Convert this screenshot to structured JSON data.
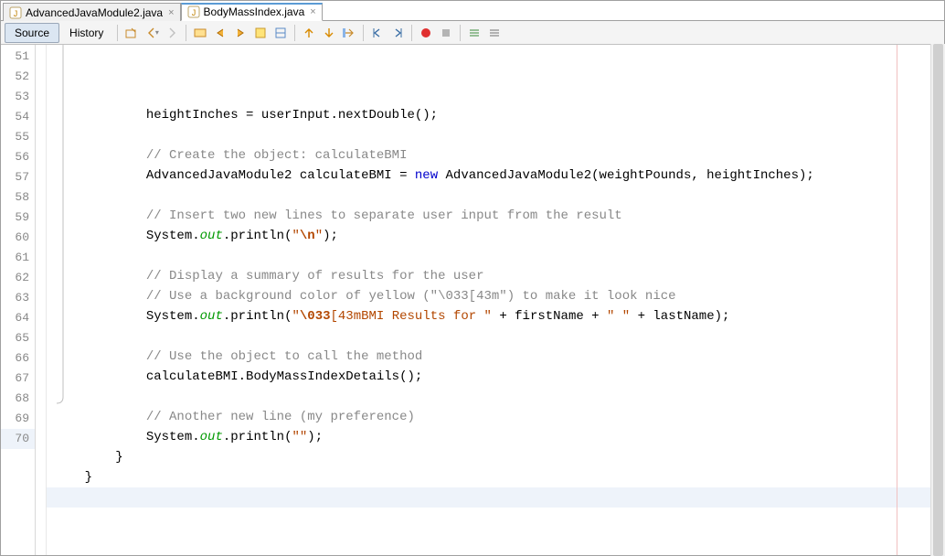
{
  "tabs": [
    {
      "label": "AdvancedJavaModule2.java",
      "active": false
    },
    {
      "label": "BodyMassIndex.java",
      "active": true
    }
  ],
  "toolbar": {
    "source_label": "Source",
    "history_label": "History"
  },
  "editor": {
    "first_line": 51,
    "last_line": 70,
    "cursor_line": 70,
    "lines": [
      {
        "n": 51,
        "indent": "            ",
        "tokens": [
          {
            "t": "pln",
            "s": "heightInches = userInput.nextDouble();"
          }
        ]
      },
      {
        "n": 52,
        "indent": "",
        "tokens": []
      },
      {
        "n": 53,
        "indent": "            ",
        "tokens": [
          {
            "t": "cmt",
            "s": "// Create the object: calculateBMI"
          }
        ]
      },
      {
        "n": 54,
        "indent": "            ",
        "tokens": [
          {
            "t": "pln",
            "s": "AdvancedJavaModule2 calculateBMI = "
          },
          {
            "t": "kw",
            "s": "new"
          },
          {
            "t": "pln",
            "s": " AdvancedJavaModule2(weightPounds, heightInches);"
          }
        ]
      },
      {
        "n": 55,
        "indent": "",
        "tokens": []
      },
      {
        "n": 56,
        "indent": "            ",
        "tokens": [
          {
            "t": "cmt",
            "s": "// Insert two new lines to separate user input from the result"
          }
        ]
      },
      {
        "n": 57,
        "indent": "            ",
        "tokens": [
          {
            "t": "pln",
            "s": "System."
          },
          {
            "t": "fld",
            "s": "out"
          },
          {
            "t": "pln",
            "s": ".println("
          },
          {
            "t": "str",
            "s": "\""
          },
          {
            "t": "esc",
            "s": "\\n"
          },
          {
            "t": "str",
            "s": "\""
          },
          {
            "t": "pln",
            "s": ");"
          }
        ]
      },
      {
        "n": 58,
        "indent": "",
        "tokens": []
      },
      {
        "n": 59,
        "indent": "            ",
        "tokens": [
          {
            "t": "cmt",
            "s": "// Display a summary of results for the user"
          }
        ]
      },
      {
        "n": 60,
        "indent": "            ",
        "tokens": [
          {
            "t": "cmt",
            "s": "// Use a background color of yellow (\"\\033[43m\") to make it look nice"
          }
        ]
      },
      {
        "n": 61,
        "indent": "            ",
        "tokens": [
          {
            "t": "pln",
            "s": "System."
          },
          {
            "t": "fld",
            "s": "out"
          },
          {
            "t": "pln",
            "s": ".println("
          },
          {
            "t": "str",
            "s": "\""
          },
          {
            "t": "esc",
            "s": "\\033"
          },
          {
            "t": "str",
            "s": "[43mBMI Results for \""
          },
          {
            "t": "pln",
            "s": " + firstName + "
          },
          {
            "t": "str",
            "s": "\" \""
          },
          {
            "t": "pln",
            "s": " + lastName);"
          }
        ]
      },
      {
        "n": 62,
        "indent": "",
        "tokens": []
      },
      {
        "n": 63,
        "indent": "            ",
        "tokens": [
          {
            "t": "cmt",
            "s": "// Use the object to call the method"
          }
        ]
      },
      {
        "n": 64,
        "indent": "            ",
        "tokens": [
          {
            "t": "pln",
            "s": "calculateBMI.BodyMassIndexDetails();"
          }
        ]
      },
      {
        "n": 65,
        "indent": "",
        "tokens": []
      },
      {
        "n": 66,
        "indent": "            ",
        "tokens": [
          {
            "t": "cmt",
            "s": "// Another new line (my preference)"
          }
        ]
      },
      {
        "n": 67,
        "indent": "            ",
        "tokens": [
          {
            "t": "pln",
            "s": "System."
          },
          {
            "t": "fld",
            "s": "out"
          },
          {
            "t": "pln",
            "s": ".println("
          },
          {
            "t": "str",
            "s": "\"\""
          },
          {
            "t": "pln",
            "s": ");"
          }
        ]
      },
      {
        "n": 68,
        "indent": "        ",
        "tokens": [
          {
            "t": "pln",
            "s": "}"
          }
        ]
      },
      {
        "n": 69,
        "indent": "    ",
        "tokens": [
          {
            "t": "pln",
            "s": "}"
          }
        ]
      },
      {
        "n": 70,
        "indent": "    ",
        "tokens": []
      }
    ]
  }
}
